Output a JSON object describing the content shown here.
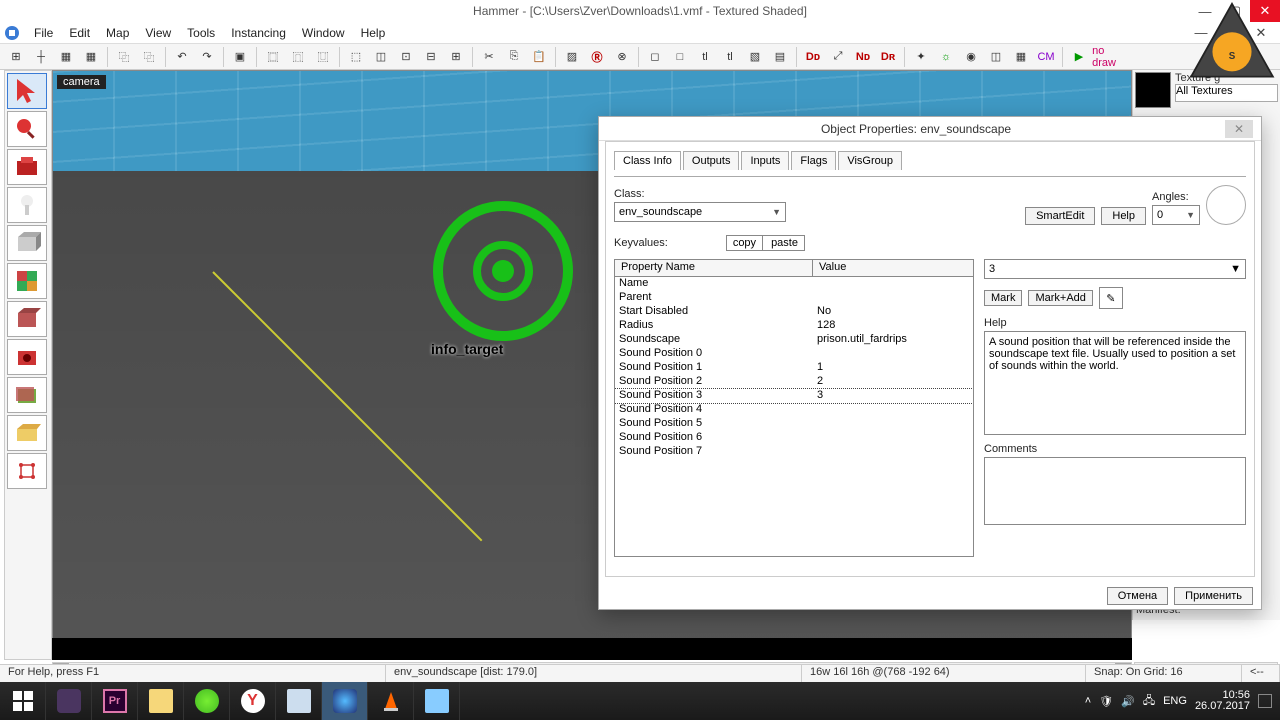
{
  "title": "Hammer - [C:\\Users\\Zver\\Downloads\\1.vmf - Textured Shaded]",
  "menu": [
    "File",
    "Edit",
    "Map",
    "View",
    "Tools",
    "Instancing",
    "Window",
    "Help"
  ],
  "right_panel": {
    "texture_group_label": "Texture g",
    "texture_select": "All Textures",
    "manifest_label": "Manifest:"
  },
  "viewport": {
    "label": "camera",
    "entity_label": "info_target"
  },
  "statusbar": {
    "help": "For Help, press F1",
    "entity": "env_soundscape   [dist: 179.0]",
    "coords": "16w 16l 16h @(768 -192 64)",
    "snap": "Snap: On Grid: 16",
    "arrow": "<--"
  },
  "tray": {
    "time": "10:56",
    "date": "26.07.2017",
    "lang": "ENG"
  },
  "dialog": {
    "title": "Object Properties: env_soundscape",
    "tabs": [
      "Class Info",
      "Outputs",
      "Inputs",
      "Flags",
      "VisGroup"
    ],
    "class_label": "Class:",
    "class_value": "env_soundscape",
    "smartedit": "SmartEdit",
    "help_btn": "Help",
    "angles_label": "Angles:",
    "angles_value": "0",
    "keyvalues_label": "Keyvalues:",
    "copy": "copy",
    "paste": "paste",
    "colheaders": {
      "name": "Property Name",
      "value": "Value"
    },
    "rows": [
      {
        "name": "Name",
        "value": ""
      },
      {
        "name": "Parent",
        "value": ""
      },
      {
        "name": "Start Disabled",
        "value": "No"
      },
      {
        "name": "Radius",
        "value": "128"
      },
      {
        "name": "Soundscape",
        "value": "prison.util_fardrips"
      },
      {
        "name": "Sound Position 0",
        "value": ""
      },
      {
        "name": "Sound Position 1",
        "value": "1"
      },
      {
        "name": "Sound Position 2",
        "value": "2"
      },
      {
        "name": "Sound Position 3",
        "value": "3"
      },
      {
        "name": "Sound Position 4",
        "value": ""
      },
      {
        "name": "Sound Position 5",
        "value": ""
      },
      {
        "name": "Sound Position 6",
        "value": ""
      },
      {
        "name": "Sound Position 7",
        "value": ""
      }
    ],
    "selected_row": 8,
    "value_input": "3",
    "mark": "Mark",
    "markadd": "Mark+Add",
    "help_label": "Help",
    "help_text": "A sound position that will be referenced inside the soundscape text file. Usually used to position a set of sounds within the world.",
    "comments_label": "Comments",
    "cancel": "Отмена",
    "apply": "Применить"
  }
}
